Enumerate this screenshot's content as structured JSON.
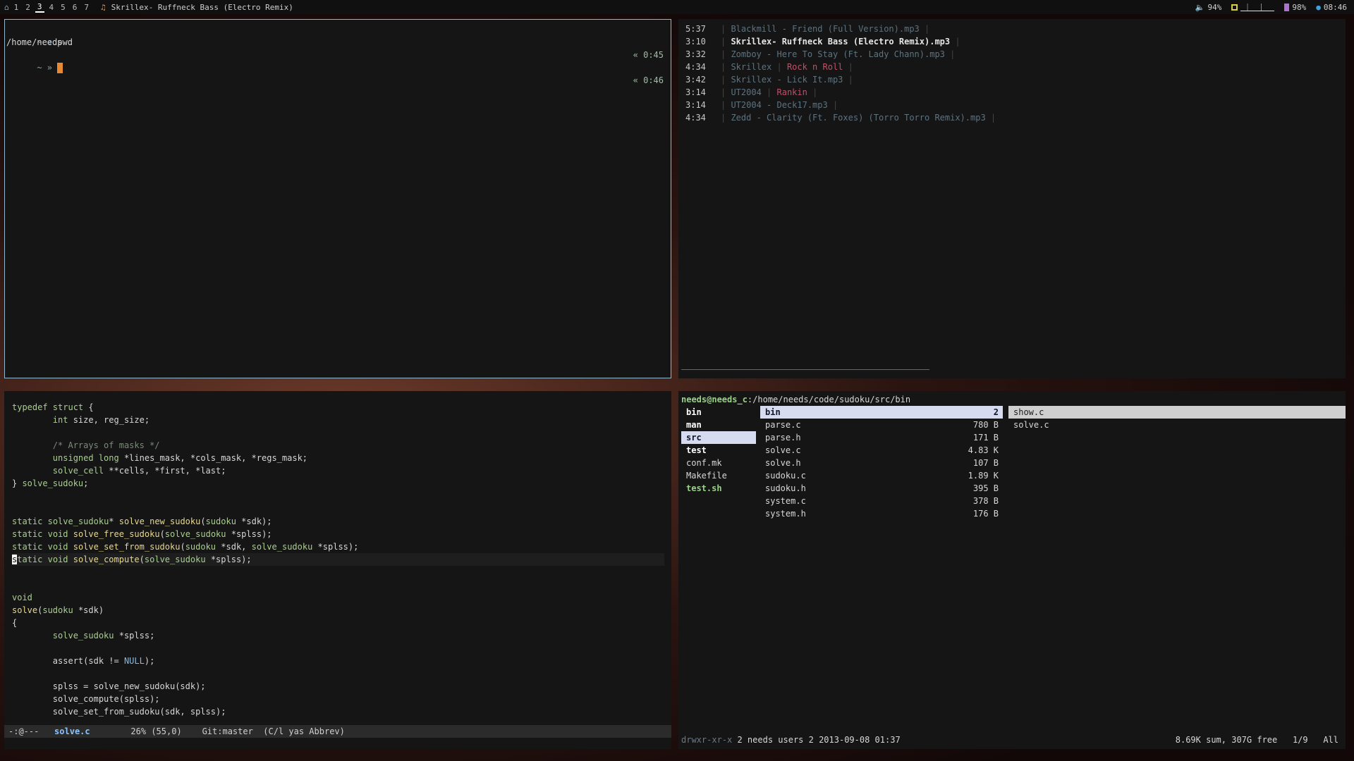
{
  "topbar": {
    "workspaces": [
      "1",
      "2",
      "3",
      "4",
      "5",
      "6",
      "7"
    ],
    "active_ws": "3",
    "window_title": "Skrillex- Ruffneck Bass (Electro Remix)",
    "volume": "94%",
    "cpu_label": "",
    "battery": "98%",
    "clock": "08:46"
  },
  "terminal": {
    "lines": [
      {
        "prompt": "~ »",
        "cmd": "pwd",
        "time": "« 0:45"
      },
      {
        "output": "/home/needs"
      },
      {
        "prompt": "~ »",
        "cmd": "",
        "time": "« 0:46"
      }
    ]
  },
  "music": {
    "tracks": [
      {
        "dur": "5:37",
        "a": "Blackmill - Friend (Full Version).mp3",
        "b": "",
        "state": "dim"
      },
      {
        "dur": "3:10",
        "a": "Skrillex- Ruffneck Bass (Electro Remix).mp3",
        "b": "",
        "state": "cur"
      },
      {
        "dur": "3:32",
        "a": "Zomboy - Here To Stay (Ft. Lady Chann).mp3",
        "b": "",
        "state": "dim"
      },
      {
        "dur": "4:34",
        "a": "Skrillex",
        "b": "Rock n Roll",
        "state": "dim"
      },
      {
        "dur": "3:42",
        "a": "Skrillex - Lick It.mp3",
        "b": "",
        "state": "dim"
      },
      {
        "dur": "3:14",
        "a": "UT2004",
        "b": "Rankin",
        "state": "dim"
      },
      {
        "dur": "3:14",
        "a": "UT2004 - Deck17.mp3",
        "b": "",
        "state": "dim"
      },
      {
        "dur": "4:34",
        "a": "Zedd - Clarity (Ft. Foxes) (Torro Torro Remix).mp3",
        "b": "",
        "state": "dim"
      }
    ]
  },
  "editor": {
    "modeline": {
      "state": "-:@---",
      "file": "solve.c",
      "pos": "26% (55,0)",
      "git": "Git:master",
      "mode": "(C/l yas Abbrev)"
    }
  },
  "files": {
    "user": "needs@needs_c",
    "path": ":/home/needs/code/sudoku/src/bin",
    "col1": [
      {
        "name": "bin",
        "kind": "dir"
      },
      {
        "name": "man",
        "kind": "dir"
      },
      {
        "name": "src",
        "kind": "sel"
      },
      {
        "name": "test",
        "kind": "dir"
      },
      {
        "name": "conf.mk",
        "kind": "file"
      },
      {
        "name": "Makefile",
        "kind": "file"
      },
      {
        "name": "test.sh",
        "kind": "exe"
      }
    ],
    "col2": [
      {
        "name": "bin",
        "size": "2",
        "kind": "sel"
      },
      {
        "name": "parse.c",
        "size": "780 B",
        "kind": "file"
      },
      {
        "name": "parse.h",
        "size": "171 B",
        "kind": "file"
      },
      {
        "name": "solve.c",
        "size": "4.83 K",
        "kind": "file"
      },
      {
        "name": "solve.h",
        "size": "107 B",
        "kind": "file"
      },
      {
        "name": "sudoku.c",
        "size": "1.89 K",
        "kind": "file"
      },
      {
        "name": "sudoku.h",
        "size": "395 B",
        "kind": "file"
      },
      {
        "name": "system.c",
        "size": "378 B",
        "kind": "file"
      },
      {
        "name": "system.h",
        "size": "176 B",
        "kind": "file"
      }
    ],
    "col3": [
      {
        "name": "show.c",
        "kind": "sel2"
      },
      {
        "name": "solve.c",
        "kind": "file"
      }
    ],
    "status": {
      "perm": "drwxr-xr-x",
      "info": "2 needs users 2 2013-09-08 01:37",
      "summary": "8.69K sum, 307G free",
      "page": "1/9",
      "scope": "All"
    }
  }
}
